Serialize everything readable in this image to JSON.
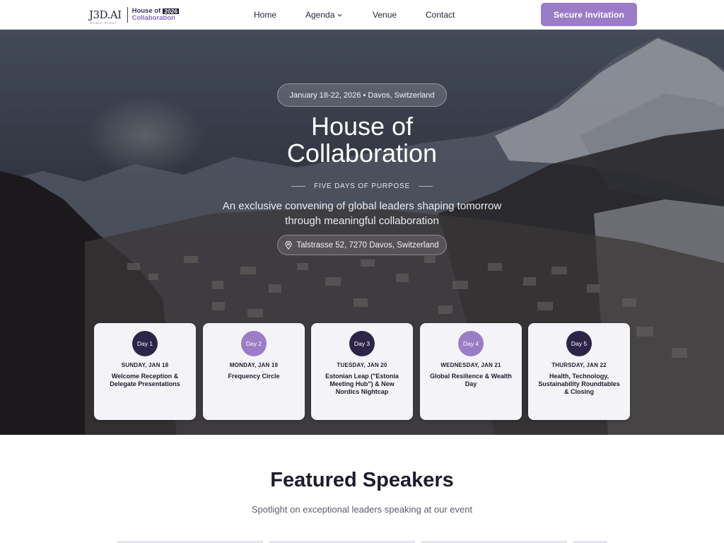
{
  "nav": {
    "logo_mark": "J3D.AI",
    "logo_mark_sub": "WORLD EVENT",
    "logo_line1": "House of",
    "logo_year": "2026",
    "logo_line2": "Collaboration",
    "items": [
      {
        "label": "Home"
      },
      {
        "label": "Agenda",
        "has_dropdown": true
      },
      {
        "label": "Venue"
      },
      {
        "label": "Contact"
      }
    ],
    "cta_label": "Secure Invitation",
    "icons": {
      "dropdown": "chevron-down-icon"
    }
  },
  "hero": {
    "date_location": "January 18-22, 2026 • Davos, Switzerland",
    "title_line1": "House of",
    "title_line2": "Collaboration",
    "tagline": "FIVE DAYS OF PURPOSE",
    "subtitle_line1": "An exclusive convening of global leaders shaping tomorrow",
    "subtitle_line2": "through meaningful collaboration",
    "address": "Talstrasse 52, 7270 Davos, Switzerland",
    "address_icon": "map-pin-icon"
  },
  "days": [
    {
      "badge": "Day 1",
      "date": "SUNDAY, JAN 18",
      "title": "Welcome Reception & Delegate Presentations",
      "style": "dark"
    },
    {
      "badge": "Day 2",
      "date": "MONDAY, JAN 19",
      "title": "Frequency Circle",
      "style": "light"
    },
    {
      "badge": "Day 3",
      "date": "TUESDAY, JAN 20",
      "title": "Estonian Leap (\"Estonia Meeting Hub\") & New Nordics Nightcap",
      "style": "dark"
    },
    {
      "badge": "Day 4",
      "date": "WEDNESDAY, JAN 21",
      "title": "Global Resilience & Wealth Day",
      "style": "light"
    },
    {
      "badge": "Day 5",
      "date": "THURSDAY, JAN 22",
      "title": "Health, Technology, Sustainability Roundtables & Closing",
      "style": "dark"
    }
  ],
  "speakers": {
    "title": "Featured Speakers",
    "subtitle": "Spotlight on exceptional leaders speaking at our event"
  },
  "colors": {
    "accent": "#9b7cc6",
    "dark": "#2c2547",
    "card_bg": "#f4f3f7"
  }
}
